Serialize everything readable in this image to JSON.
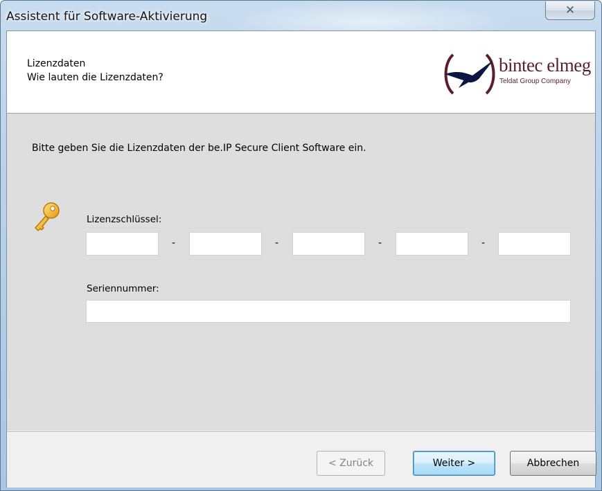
{
  "window": {
    "title": "Assistent für Software-Aktivierung",
    "close_glyph": "✕"
  },
  "header": {
    "title": "Lizenzdaten",
    "subtitle": "Wie lauten die Lizenzdaten?",
    "logo": {
      "brand": "bintec elmeg",
      "tagline": "Teldat Group Company",
      "color": "#5b1e2e"
    }
  },
  "main": {
    "instruction": "Bitte geben Sie die Lizenzdaten der be.IP Secure Client Software ein.",
    "license_key": {
      "label": "Lizenzschlüssel:",
      "icon": "key-icon",
      "segments": [
        "",
        "",
        "",
        "",
        ""
      ],
      "separator": "-"
    },
    "serial": {
      "label": "Seriennummer:",
      "value": ""
    }
  },
  "footer": {
    "back_label": "< Zurück",
    "next_label": "Weiter >",
    "cancel_label": "Abbrechen"
  }
}
